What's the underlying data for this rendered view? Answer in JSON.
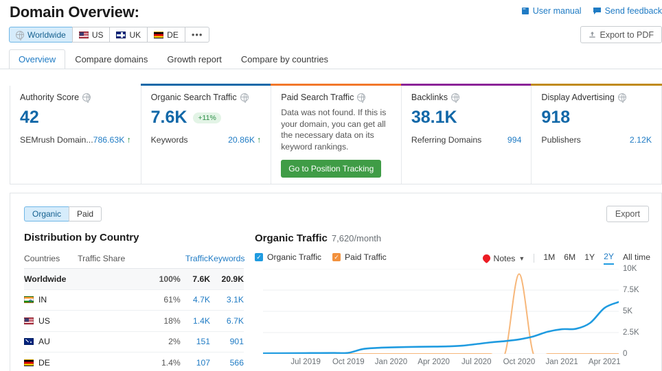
{
  "header": {
    "title": "Domain Overview:",
    "user_manual": "User manual",
    "send_feedback": "Send feedback",
    "export_pdf": "Export to PDF"
  },
  "regions": [
    {
      "label": "Worldwide",
      "icon": "globe-icon",
      "selected": true
    },
    {
      "label": "US",
      "icon": "flag-us",
      "selected": false
    },
    {
      "label": "UK",
      "icon": "flag-uk",
      "selected": false
    },
    {
      "label": "DE",
      "icon": "flag-de",
      "selected": false
    },
    {
      "label": "•••",
      "icon": "more-icon",
      "selected": false
    }
  ],
  "tabs": [
    {
      "label": "Overview",
      "active": true
    },
    {
      "label": "Compare domains",
      "active": false
    },
    {
      "label": "Growth report",
      "active": false
    },
    {
      "label": "Compare by countries",
      "active": false
    }
  ],
  "cards": [
    {
      "title": "Authority Score",
      "accent": "#ffffff",
      "value": "42",
      "badge": "",
      "row_label": "SEMrush Domain...",
      "row_value": "786.63K",
      "trend": "↑"
    },
    {
      "title": "Organic Search Traffic",
      "accent": "#1268a8",
      "value": "7.6K",
      "badge": "+11%",
      "row_label": "Keywords",
      "row_value": "20.86K",
      "trend": "↑"
    },
    {
      "title": "Paid Search Traffic",
      "accent": "#f2772a",
      "note": "Data was not found. If this is your domain, you can get all the necessary data on its keyword rankings.",
      "button": "Go to Position Tracking"
    },
    {
      "title": "Backlinks",
      "accent": "#8b2397",
      "value": "38.1K",
      "badge": "",
      "row_label": "Referring Domains",
      "row_value": "994",
      "trend": ""
    },
    {
      "title": "Display Advertising",
      "accent": "#c08a16",
      "value": "918",
      "badge": "",
      "row_label": "Publishers",
      "row_value": "2.12K",
      "trend": ""
    }
  ],
  "panel": {
    "segments": [
      {
        "label": "Organic",
        "selected": true
      },
      {
        "label": "Paid",
        "selected": false
      }
    ],
    "export_label": "Export",
    "distribution_title": "Distribution by Country",
    "table": {
      "columns": [
        "Countries",
        "Traffic Share",
        "Traffic",
        "Keywords"
      ],
      "rows": [
        {
          "country": "Worldwide",
          "flag": "",
          "share_pct": 100,
          "share_label": "100%",
          "traffic": "7.6K",
          "keywords": "20.9K"
        },
        {
          "country": "IN",
          "flag": "flag-in",
          "share_pct": 61,
          "share_label": "61%",
          "traffic": "4.7K",
          "keywords": "3.1K"
        },
        {
          "country": "US",
          "flag": "flag-us",
          "share_pct": 18,
          "share_label": "18%",
          "traffic": "1.4K",
          "keywords": "6.7K"
        },
        {
          "country": "AU",
          "flag": "flag-au",
          "share_pct": 2,
          "share_label": "2%",
          "traffic": "151",
          "keywords": "901"
        },
        {
          "country": "DE",
          "flag": "flag-de",
          "share_pct": 1.4,
          "share_label": "1.4%",
          "traffic": "107",
          "keywords": "566"
        }
      ]
    }
  },
  "chart_panel": {
    "title": "Organic Traffic",
    "subtitle": "7,620/month",
    "legend": [
      {
        "label": "Organic Traffic",
        "color": "#1f9be0",
        "checked": true
      },
      {
        "label": "Paid Traffic",
        "color": "#f2913d",
        "checked": true
      }
    ],
    "notes_label": "Notes",
    "ranges": [
      {
        "label": "1M",
        "active": false
      },
      {
        "label": "6M",
        "active": false
      },
      {
        "label": "1Y",
        "active": false
      },
      {
        "label": "2Y",
        "active": true
      },
      {
        "label": "All time",
        "active": false
      }
    ]
  },
  "chart_data": {
    "type": "line",
    "title": "Organic Traffic",
    "subtitle": "7,620/month",
    "xlabel": "",
    "ylabel": "",
    "ylim": [
      0,
      10000
    ],
    "yticks": [
      0,
      2500,
      5000,
      7500,
      10000
    ],
    "ytick_labels": [
      "0",
      "2.5K",
      "5K",
      "7.5K",
      "10K"
    ],
    "xtick_labels": [
      "Jul 2019",
      "Oct 2019",
      "Jan 2020",
      "Apr 2020",
      "Jul 2020",
      "Oct 2020",
      "Jan 2021",
      "Apr 2021"
    ],
    "grid": true,
    "legend_position": "top-left",
    "series": [
      {
        "name": "Organic Traffic",
        "color": "#1f9be0",
        "x": [
          "Apr 2019",
          "May 2019",
          "Jun 2019",
          "Jul 2019",
          "Aug 2019",
          "Sep 2019",
          "Oct 2019",
          "Nov 2019",
          "Dec 2019",
          "Jan 2020",
          "Feb 2020",
          "Mar 2020",
          "Apr 2020",
          "May 2020",
          "Jun 2020",
          "Jul 2020",
          "Aug 2020",
          "Sep 2020",
          "Oct 2020",
          "Nov 2020",
          "Dec 2020",
          "Jan 2021",
          "Feb 2021",
          "Mar 2021",
          "Apr 2021",
          "May 2021"
        ],
        "values": [
          60,
          70,
          80,
          90,
          100,
          110,
          120,
          560,
          700,
          760,
          800,
          830,
          850,
          880,
          960,
          1150,
          1350,
          1500,
          1700,
          2050,
          2600,
          2900,
          2950,
          3650,
          5400,
          6100
        ]
      },
      {
        "name": "Paid Traffic",
        "color": "#f7b77a",
        "x": [
          "Apr 2019",
          "May 2019",
          "Jun 2019",
          "Jul 2019",
          "Aug 2019",
          "Sep 2019",
          "Oct 2019",
          "Nov 2019",
          "Dec 2019",
          "Jan 2020",
          "Feb 2020",
          "Mar 2020",
          "Apr 2020",
          "May 2020",
          "Jun 2020",
          "Jul 2020",
          "Aug 2020",
          "Sep 2020",
          "Oct 2020",
          "Nov 2020",
          "Dec 2020",
          "Jan 2021",
          "Feb 2021",
          "Mar 2021",
          "Apr 2021",
          "May 2021"
        ],
        "values": [
          0,
          0,
          0,
          0,
          0,
          0,
          0,
          0,
          0,
          0,
          0,
          0,
          0,
          0,
          0,
          0,
          0,
          0,
          9400,
          0,
          0,
          0,
          0,
          0,
          0,
          0
        ]
      }
    ]
  }
}
